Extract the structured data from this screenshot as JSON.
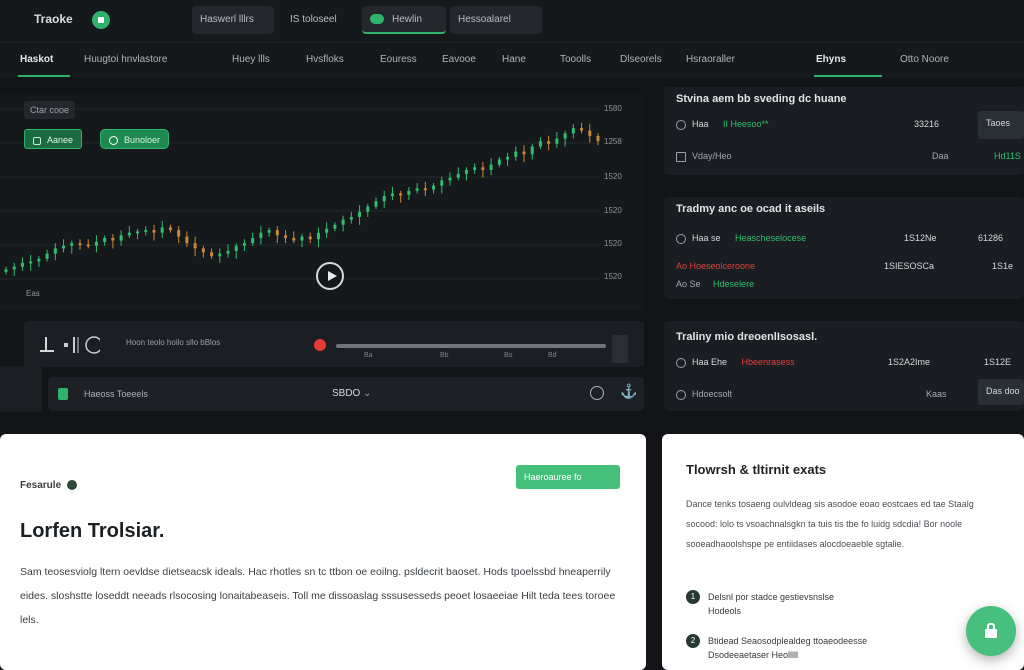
{
  "app": {
    "logo_text": "Traoke"
  },
  "top_tabs": [
    {
      "label": "Haswerl lllrs"
    },
    {
      "label": "IS toloseel"
    },
    {
      "label": "Hewlin"
    },
    {
      "label": "Hessoalarel"
    }
  ],
  "nav": [
    {
      "label": "Haskot"
    },
    {
      "label": "Huugtoi hnvlastore"
    },
    {
      "label": "Huey llls"
    },
    {
      "label": "Hvsfloks"
    },
    {
      "label": "Eouress"
    },
    {
      "label": "Eavooe"
    },
    {
      "label": "Hane"
    },
    {
      "label": "Tooolls"
    },
    {
      "label": "Dlseorels"
    },
    {
      "label": "Hsraoraller"
    },
    {
      "label": "Ehyns"
    },
    {
      "label": "Otto Noore"
    }
  ],
  "chart_panel": {
    "title": "Ctar cooe",
    "chip_1": "Aanee",
    "chip_2": "Bunoloer",
    "price_ticks": [
      "1580",
      "1258",
      "1520",
      "1520",
      "1520",
      "1520"
    ],
    "corner_label": "Eas"
  },
  "chart_data": {
    "type": "candlestick",
    "title": "",
    "xlabel": "",
    "ylabel": "",
    "series": [
      {
        "values": [
          42,
          44,
          47,
          48,
          50,
          54,
          58,
          60,
          62,
          61,
          60,
          63,
          66,
          64,
          68,
          70,
          71,
          72,
          70,
          74,
          72,
          67,
          62,
          58,
          55,
          52,
          54,
          56,
          60,
          62,
          66,
          70,
          72,
          68,
          66,
          64,
          67,
          65,
          70,
          73,
          76,
          80,
          82,
          86,
          90,
          94,
          98,
          100,
          99,
          102,
          104,
          103,
          106,
          110,
          112,
          115,
          118,
          120,
          118,
          122,
          126,
          128,
          132,
          130,
          136,
          140,
          138,
          142,
          146,
          150,
          148,
          144,
          140
        ]
      }
    ]
  },
  "transport": {
    "timeline_text": "Hoon teolo hoilo sllo bBlos",
    "ticks": [
      "Ba",
      "Bb",
      "Bo",
      "Bd"
    ]
  },
  "tool_row": {
    "label": "Haeoss Toeeels",
    "value": "SBDO"
  },
  "right_cards": [
    {
      "title": "Stvina aem bb sveding dc huane",
      "rows": [
        {
          "a": "Haa",
          "b": "II Heesoo**",
          "c": "33216",
          "btn": "Taoes"
        },
        {
          "a": "Vday/Heo",
          "b": "",
          "c": "Daa",
          "d": "Hd11S"
        }
      ]
    },
    {
      "title": "Tradmy anc oe ocad it aseils",
      "rows": [
        {
          "a": "Haa se",
          "b": "Heascheselocese",
          "c": "1S12Ne",
          "d": "61286"
        },
        {
          "a": "Ao Hoeseolceroone",
          "b": "",
          "c": "1SIESOSCa",
          "d": "1S1e"
        },
        {
          "a": "Ao Se",
          "b": "Hdeselere",
          "c": "",
          "d": ""
        }
      ]
    },
    {
      "title": "Traliny mio dreoenlIsosasl.",
      "rows": [
        {
          "a": "Haa Ehe",
          "b": "Hbeenrasess",
          "c": "1S2A2Ime",
          "d": "1S12E"
        },
        {
          "a": "Hdoecsolt",
          "b": "",
          "c": "Kaas",
          "btn": "Das doo"
        }
      ]
    }
  ],
  "main_card": {
    "label": "Fesarule",
    "cta": "Haeroauree fo",
    "heading": "Lorfen Trolsiar.",
    "paragraph": "Sam teosesviolg ltern oevldse dietseacsk ideals. Hac rhotles sn tc ttbon oe eoilng. psldecrit baoset. Hods tpoelssbd hneaperrily eides. sloshstte loseddt neeads rlsocosing lonaitabeaseis. Toll me dissoaslag sssusesseds peoet losaeeiae Hilt teda tees toroee lels."
  },
  "side_card": {
    "title": "Tlowrsh & tltirnit exats",
    "paragraph": "Dance tenks tosaeng oulvldeag sis asodoe eoao eostcaes ed tae Staalg socood: lolo ts vsoachnalsgkn ta tuis tis tbe fo luidg sdcdia! Bor noole sooeadhaoolshspe pe entiidases alocdoeaeble sgtalie.",
    "items": [
      {
        "num": "1",
        "line1": "Delsnl por stadce gestievsnslse",
        "line2": "Hodeols"
      },
      {
        "num": "2",
        "line1": "Btidead Seaosodplealdeg ttoaeodeesse",
        "line2": "Dsodeeaetaser Heolllll"
      }
    ]
  }
}
